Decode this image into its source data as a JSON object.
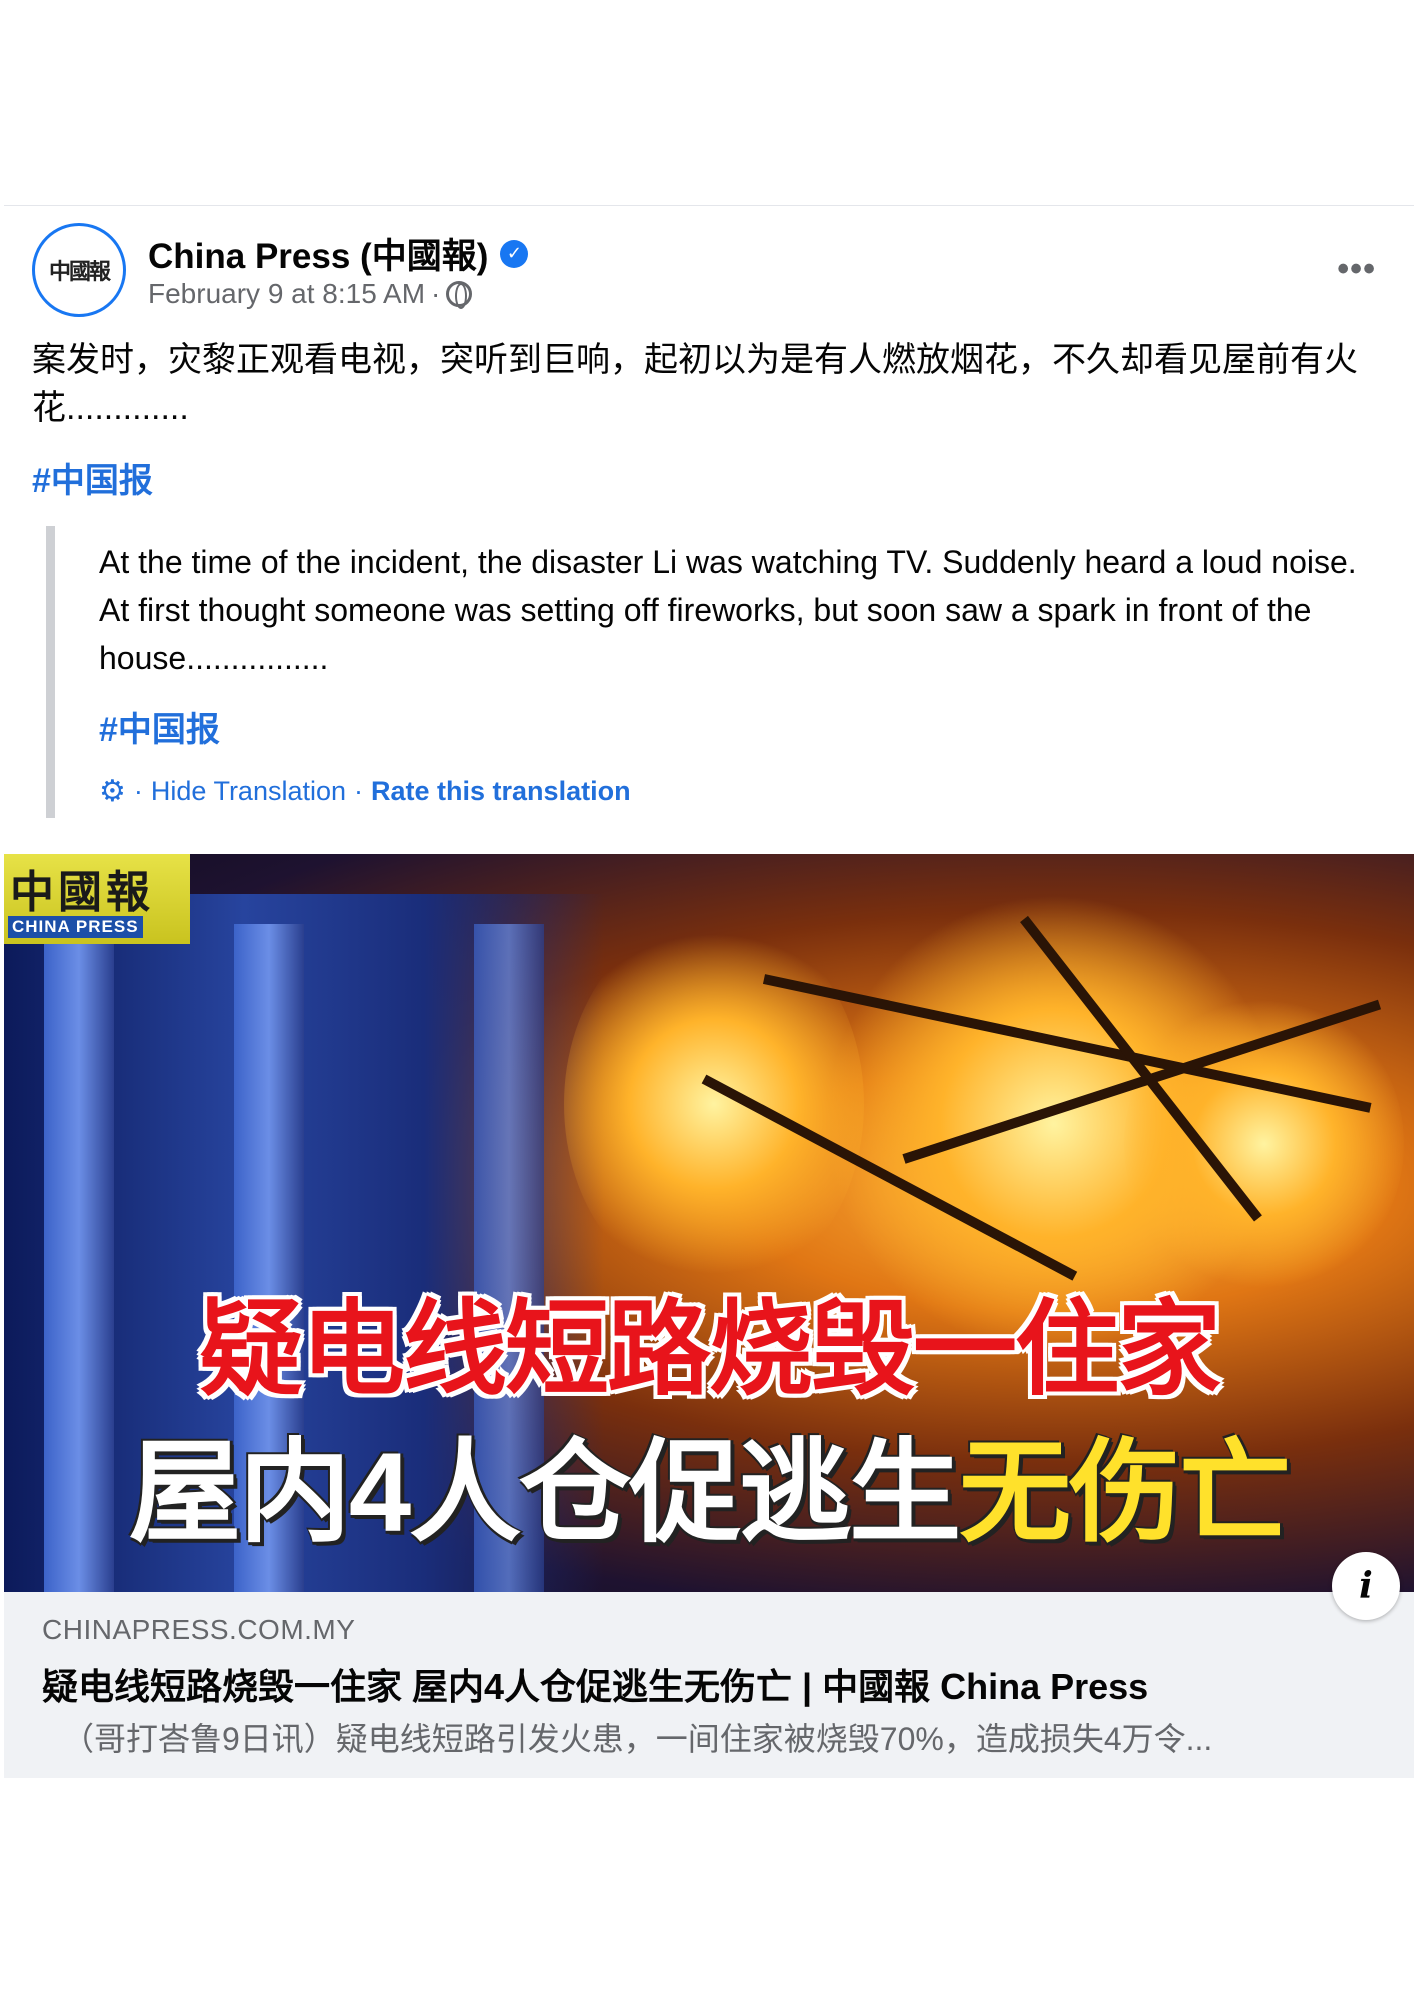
{
  "post": {
    "page_name": "China Press (中國報)",
    "avatar_text": "中國報",
    "timestamp": "February 9 at 8:15 AM",
    "meta_separator": "·",
    "more_label": "•••",
    "text": "案发时，灾黎正观看电视，突听到巨响，起初以为是有人燃放烟花，不久却看见屋前有火花.............",
    "hashtag": "#中国报"
  },
  "translation": {
    "text": "At the time of the incident, the disaster Li was watching TV. Suddenly heard a loud noise. At first thought someone was setting off fireworks, but soon saw a spark in front of the house................",
    "hashtag": "#中国报",
    "separator": "·",
    "hide_label": "Hide Translation",
    "rate_label": "Rate this translation"
  },
  "link_image": {
    "logo_cn": "中國報",
    "logo_en": "CHINA PRESS",
    "headline_1": "疑电线短路烧毁一住家",
    "headline_2_white": "屋内4人仓促逃生",
    "headline_2_yellow": "无伤亡"
  },
  "link_preview": {
    "domain": "CHINAPRESS.COM.MY",
    "title": "疑电线短路烧毁一住家 屋内4人仓促逃生无伤亡 | 中國報 China Press",
    "description": "（哥打峇鲁9日讯）疑电线短路引发火患，一间住家被烧毁70%，造成损失4万令..."
  },
  "icons": {
    "verified": "verified-badge-icon",
    "globe": "globe-icon",
    "gear": "gear-icon",
    "info": "info-icon"
  },
  "colors": {
    "link_blue": "#216fdb",
    "verified_blue": "#1877f2",
    "secondary_text": "#65676b",
    "preview_bg": "#f0f2f5",
    "headline_red": "#e8141b",
    "headline_yellow": "#ffe12b"
  }
}
